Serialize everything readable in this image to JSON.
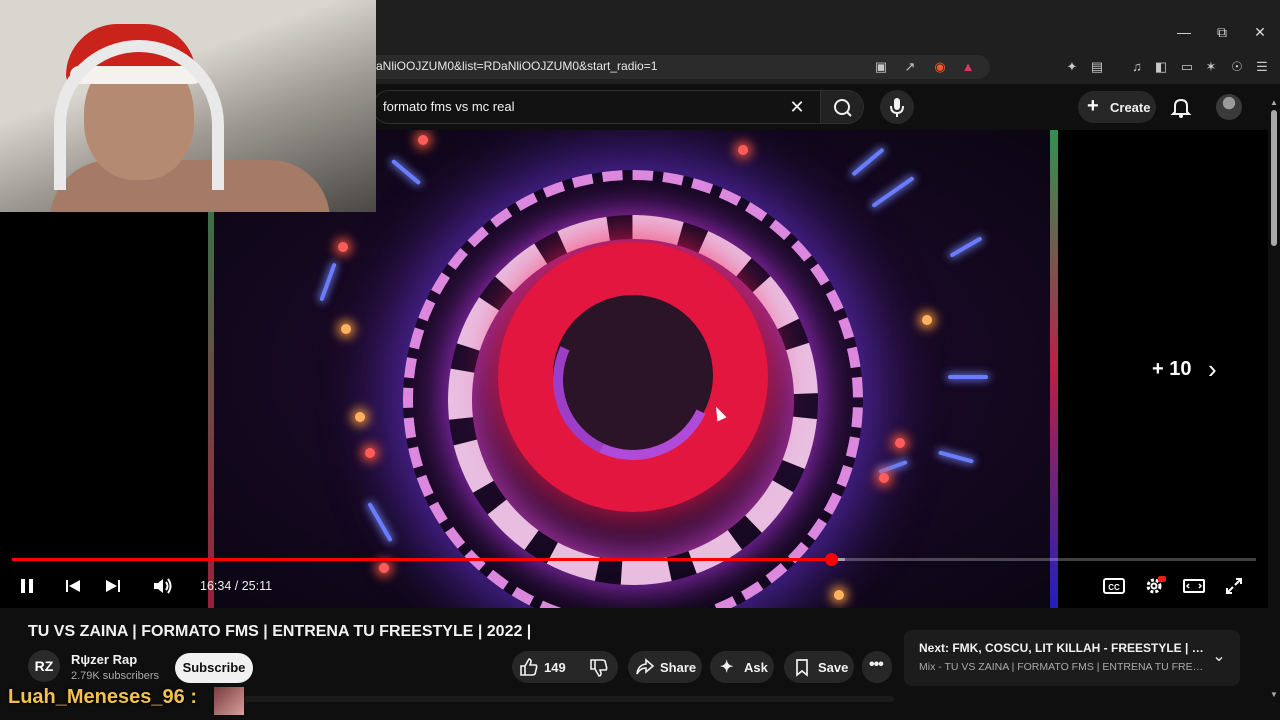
{
  "browser": {
    "url": "aNliOOJZUM0&list=RDaNliOOJZUM0&start_radio=1",
    "window_controls": [
      "minimize-icon",
      "restore-icon",
      "close-icon"
    ],
    "address_icons": [
      "cast-icon",
      "share-icon",
      "brave-shield-icon",
      "brave-rewards-icon"
    ],
    "toolbar_icons": [
      "extensions-icon",
      "screenshot-icon",
      "music-icon",
      "sidebar-icon",
      "wallet-icon",
      "leo-ai-icon",
      "vpn-icon",
      "menu-icon"
    ]
  },
  "youtube_header": {
    "search_query": "formato fms vs mc real",
    "create_label": "Create",
    "create_icon": "plus-icon",
    "bell_icon": "bell-icon"
  },
  "player": {
    "current_time": "16:34",
    "duration": "25:11",
    "time_display": "16:34 / 25:11",
    "progress_fraction": 0.658,
    "buffered_fraction": 0.67,
    "skip_label": "+ 10",
    "colors": {
      "progress": "#ff0000",
      "ring_red": "#e2163f",
      "ring_glow": "#c83cff"
    }
  },
  "video": {
    "title": "TU VS ZAINA | FORMATO FMS | ENTRENA TU FREESTYLE | 2022 |",
    "channel_avatar_text": "RZ",
    "channel_name": "Rψzer Rap",
    "subscribers": "2.79K subscribers",
    "subscribe_label": "Subscribe",
    "like_count": "149",
    "share_label": "Share",
    "ask_label": "Ask",
    "save_label": "Save"
  },
  "next_card": {
    "title": "Next: FMK, COSCU, LIT KILLAH - FREESTYLE | MEDI...",
    "subtitle": "Mix - TU VS ZAINA | FORMATO FMS | ENTRENA TU FREESTY..."
  },
  "stream_overlay": {
    "username": "Luah_Meneses_96 :"
  }
}
